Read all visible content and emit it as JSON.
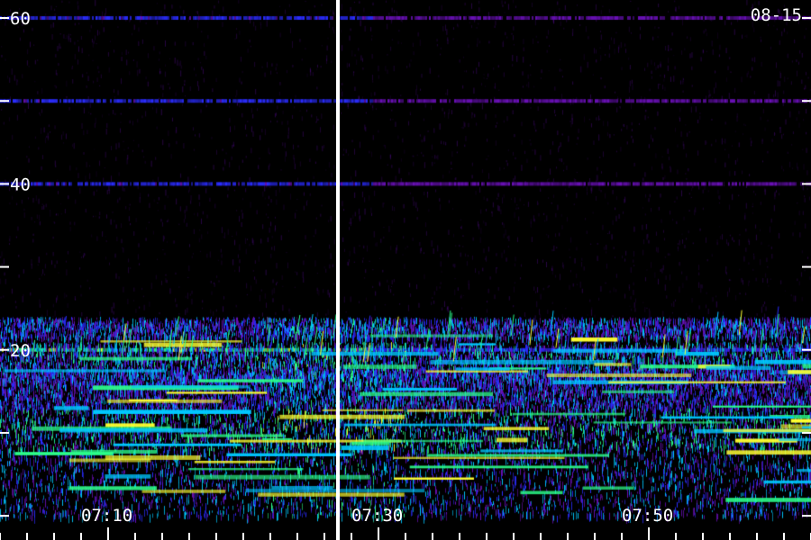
{
  "chart_data": {
    "type": "heatmap",
    "title": "",
    "date_stamp": "08-15",
    "xlabel": "",
    "ylabel": "",
    "x_tick_labels": [
      "07:10",
      "07:30",
      "07:50"
    ],
    "x_tick_minutes": [
      10,
      30,
      50
    ],
    "x_range_minutes": [
      2,
      62
    ],
    "y_tick_values": [
      0,
      10,
      20,
      30,
      40,
      50,
      60
    ],
    "y_tick_labels": [
      "20",
      "40",
      "60"
    ],
    "y_range": [
      -4,
      60
    ],
    "marker_minutes": 27,
    "grid": false,
    "legend": "none",
    "colors": {
      "background": "#000000",
      "low": "#6a10b8",
      "mid_low": "#2a2cff",
      "mid": "#00c8ff",
      "mid_high": "#2cff8a",
      "high": "#ffff30",
      "axis": "#ffffff"
    },
    "tonal_lines": [
      {
        "freq": 20,
        "level": 0.75
      },
      {
        "freq": 40,
        "level": 0.3
      },
      {
        "freq": 50,
        "level": 0.32
      },
      {
        "freq": 60,
        "level": 0.3
      }
    ],
    "band_activity": [
      {
        "from": 21.5,
        "to": 24,
        "level": 0.55
      },
      {
        "from": 18,
        "to": 21,
        "level": 0.7
      },
      {
        "from": 16,
        "to": 18,
        "level": 0.55
      },
      {
        "from": 13,
        "to": 16,
        "level": 0.5
      },
      {
        "from": 8,
        "to": 13,
        "level": 0.8
      },
      {
        "from": 0,
        "to": 8,
        "level": 0.6
      }
    ]
  }
}
